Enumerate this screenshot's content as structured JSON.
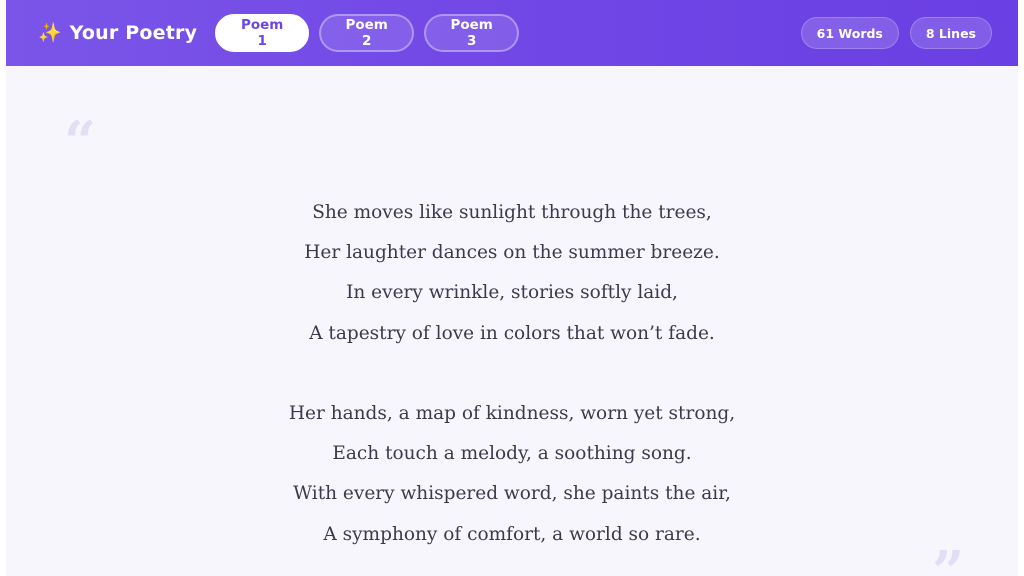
{
  "header": {
    "brand_icon": "sparkles-icon",
    "brand_icon_glyph": "✨",
    "title": "Your Poetry",
    "tabs": [
      {
        "label": "Poem 1",
        "active": true
      },
      {
        "label": "Poem 2",
        "active": false
      },
      {
        "label": "Poem 3",
        "active": false
      }
    ],
    "stats": {
      "words": "61 Words",
      "lines": "8 Lines"
    }
  },
  "poem": {
    "open_quote": "“",
    "close_quote": "”",
    "stanzas": [
      {
        "lines": [
          "She moves like sunlight through the trees,",
          "Her laughter dances on the summer breeze.",
          "In every wrinkle, stories softly laid,",
          "A tapestry of love in colors that won’t fade."
        ]
      },
      {
        "lines": [
          "Her hands, a map of kindness, worn yet strong,",
          "Each touch a melody, a soothing song.",
          "With every whispered word, she paints the air,",
          "A symphony of comfort, a world so rare."
        ]
      }
    ]
  },
  "colors": {
    "header_gradient_start": "#7b55e8",
    "header_gradient_end": "#6a3fe4",
    "active_tab_text": "#6d46e5",
    "content_background": "#f8f6fd",
    "poem_text": "#3a3a4a",
    "quote_mark": "#e4def5",
    "brand_icon": "#ffd86b"
  }
}
